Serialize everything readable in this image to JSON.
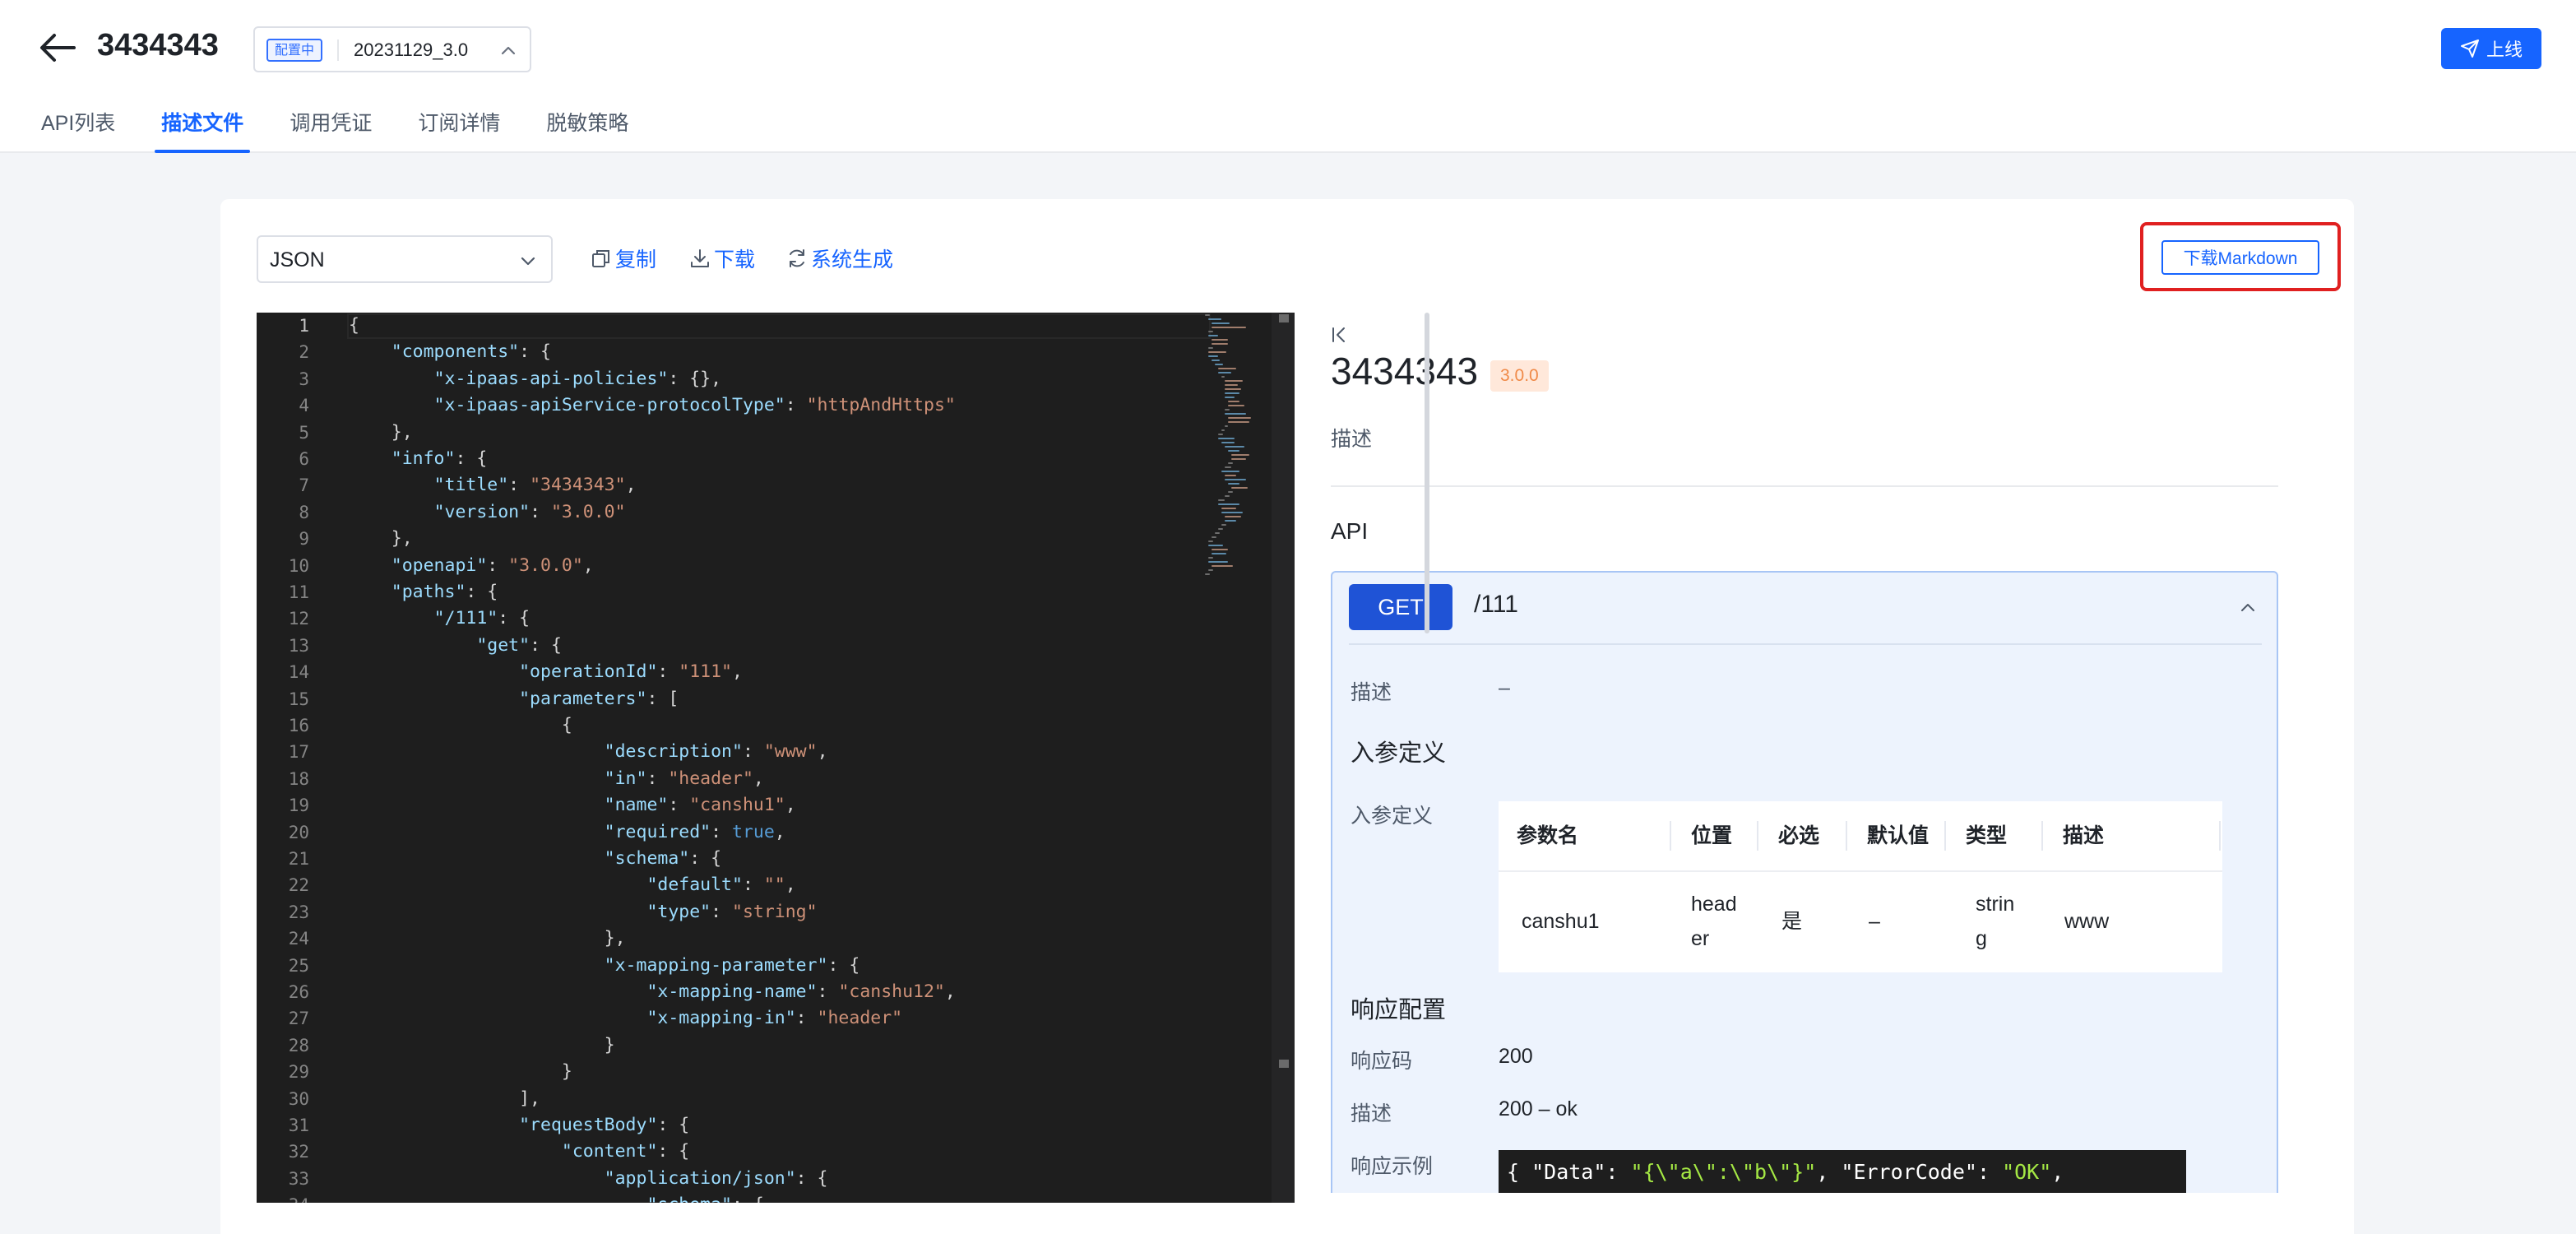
{
  "header": {
    "title": "3434343",
    "version": {
      "status_tag": "配置中",
      "value": "20231129_3.0"
    },
    "online_button": "上线"
  },
  "tabs": [
    {
      "label": "API列表",
      "active": false
    },
    {
      "label": "描述文件",
      "active": true
    },
    {
      "label": "调用凭证",
      "active": false
    },
    {
      "label": "订阅详情",
      "active": false
    },
    {
      "label": "脱敏策略",
      "active": false
    }
  ],
  "toolbar": {
    "format_value": "JSON",
    "copy_label": "复制",
    "download_label": "下载",
    "generate_label": "系统生成",
    "download_markdown_label": "下载Markdown"
  },
  "editor": {
    "lines": [
      "{",
      "    \"components\": {",
      "        \"x-ipaas-api-policies\": {},",
      "        \"x-ipaas-apiService-protocolType\": \"httpAndHttps\"",
      "    },",
      "    \"info\": {",
      "        \"title\": \"3434343\",",
      "        \"version\": \"3.0.0\"",
      "    },",
      "    \"openapi\": \"3.0.0\",",
      "    \"paths\": {",
      "        \"/111\": {",
      "            \"get\": {",
      "                \"operationId\": \"111\",",
      "                \"parameters\": [",
      "                    {",
      "                        \"description\": \"www\",",
      "                        \"in\": \"header\",",
      "                        \"name\": \"canshu1\",",
      "                        \"required\": true,",
      "                        \"schema\": {",
      "                            \"default\": \"\",",
      "                            \"type\": \"string\"",
      "                        },",
      "                        \"x-mapping-parameter\": {",
      "                            \"x-mapping-name\": \"canshu12\",",
      "                            \"x-mapping-in\": \"header\"",
      "                        }",
      "                    }",
      "                ],",
      "                \"requestBody\": {",
      "                    \"content\": {",
      "                        \"application/json\": {",
      "                            \"schema\": {"
    ]
  },
  "preview": {
    "title": "3434343",
    "version_badge": "3.0.0",
    "description": "描述",
    "api_section": "API",
    "api": {
      "method": "GET",
      "path": "/111",
      "desc_label": "描述",
      "desc_value": "–",
      "params_heading": "入参定义",
      "params_label": "入参定义",
      "table_headers": [
        "参数名",
        "位置",
        "必选",
        "默认值",
        "类型",
        "描述"
      ],
      "table_row": {
        "name": "canshu1",
        "in_line1": "head",
        "in_line2": "er",
        "required": "是",
        "default": "–",
        "type_line1": "strin",
        "type_line2": "g",
        "desc": "www"
      },
      "response_heading": "响应配置",
      "code_label": "响应码",
      "code_value": "200",
      "resp_desc_label": "描述",
      "resp_desc_value": "200 – ok",
      "example_label": "响应示例",
      "example": {
        "p1": "{ \"Data\": ",
        "v1": "\"{\\\"a\\\":\\\"b\\\"}\"",
        "p2": ", \"ErrorCode\": ",
        "v2": "\"OK\"",
        "p3": ","
      }
    }
  },
  "colors": {
    "primary": "#1664ff",
    "highlight_border": "#e02020",
    "get_badge": "#1f53d6",
    "version_badge_bg": "#ffe8da",
    "version_badge_text": "#f08a48",
    "editor_bg": "#1e1e1e"
  }
}
